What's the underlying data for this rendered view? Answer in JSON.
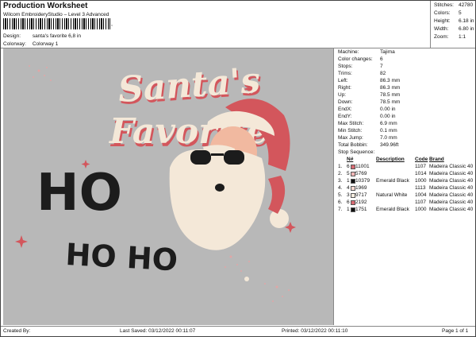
{
  "header": {
    "title": "Production Worksheet",
    "subtitle": "Wilcom EmbroideryStudio – Level 3 Advanced",
    "barcode_suffix": ",",
    "design_label": "Design:",
    "design_value": "santa's favorite 6,8 in",
    "colorway_label": "Colorway:",
    "colorway_value": "Colorway 1"
  },
  "stats": [
    {
      "label": "Stitches:",
      "value": "42780"
    },
    {
      "label": "Colors:",
      "value": "5"
    },
    {
      "label": "Height:",
      "value": "6.18 in"
    },
    {
      "label": "Width:",
      "value": "6.80 in"
    },
    {
      "label": "Zoom:",
      "value": "1:1"
    }
  ],
  "design": {
    "line1": "Santa's",
    "line2": "Favorite",
    "ho_big": "HO",
    "ho_small": "HO HO",
    "colors": {
      "background": "#b8b8b8",
      "pink": "#e7a3a4",
      "cream": "#f4e8d8",
      "salmon": "#f08f88",
      "dark": "#1c1c1c",
      "red": "#d3565c"
    }
  },
  "info": [
    {
      "label": "Machine:",
      "value": "Tajima"
    },
    {
      "label": "Color changes:",
      "value": "6"
    },
    {
      "label": "Stops:",
      "value": "7"
    },
    {
      "label": "Trims:",
      "value": "82"
    },
    {
      "label": "Left:",
      "value": "86.3 mm"
    },
    {
      "label": "Right:",
      "value": "86.3 mm"
    },
    {
      "label": "Up:",
      "value": "78.5 mm"
    },
    {
      "label": "Down:",
      "value": "78.5 mm"
    },
    {
      "label": "EndX:",
      "value": "0.00 in"
    },
    {
      "label": "EndY:",
      "value": "0.00 in"
    },
    {
      "label": "Max Stitch:",
      "value": "6.9 mm"
    },
    {
      "label": "Min Stitch:",
      "value": "0.1 mm"
    },
    {
      "label": "Max Jump:",
      "value": "7.0 mm"
    },
    {
      "label": "Total Bobbin:",
      "value": "349.96ft"
    }
  ],
  "stop_sequence": {
    "title": "Stop Sequence:",
    "headers": {
      "n": "N#",
      "code": "Code",
      "brand": "Brand",
      "description": "Description"
    },
    "rows": [
      {
        "idx": "1.",
        "n": "6",
        "color": "#d86a72",
        "stitches": "11001",
        "description": "",
        "code": "1107",
        "brand": "Madeira Classic 40"
      },
      {
        "idx": "2.",
        "n": "5",
        "color": "#f0b6b6",
        "stitches": "5769",
        "description": "",
        "code": "1014",
        "brand": "Madeira Classic 40"
      },
      {
        "idx": "3.",
        "n": "1",
        "color": "#111111",
        "stitches": "10379",
        "description": "Emerald Black",
        "code": "1000",
        "brand": "Madeira Classic 40"
      },
      {
        "idx": "4.",
        "n": "4",
        "color": "#f7d8d0",
        "stitches": "1969",
        "description": "",
        "code": "1113",
        "brand": "Madeira Classic 40"
      },
      {
        "idx": "5.",
        "n": "3",
        "color": "#f6eee0",
        "stitches": "9717",
        "description": "Natural White",
        "code": "1004",
        "brand": "Madeira Classic 40"
      },
      {
        "idx": "6.",
        "n": "6",
        "color": "#d86a72",
        "stitches": "2192",
        "description": "",
        "code": "1107",
        "brand": "Madeira Classic 40"
      },
      {
        "idx": "7.",
        "n": "1",
        "color": "#111111",
        "stitches": "1751",
        "description": "Emerald Black",
        "code": "1000",
        "brand": "Madeira Classic 40"
      }
    ]
  },
  "footer": {
    "created_by": "Created By:",
    "last_saved": "Last Saved: 03/12/2022 00:11:07",
    "printed": "Printed: 03/12/2022 00:11:10",
    "page": "Page 1 of 1"
  }
}
